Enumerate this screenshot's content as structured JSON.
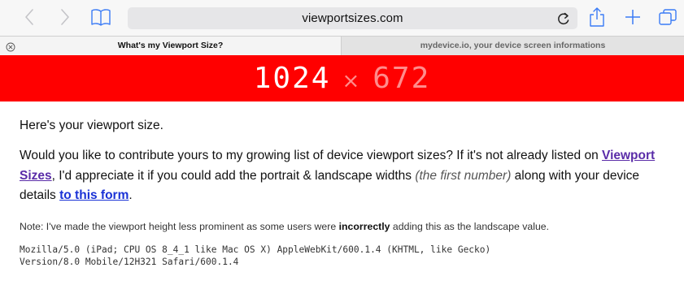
{
  "browser": {
    "address": "viewportsizes.com",
    "icons": {
      "back": "chevron-left-icon",
      "forward": "chevron-right-icon",
      "bookmarks": "open-book-icon",
      "reload": "reload-icon",
      "share": "share-icon",
      "new_tab": "plus-icon",
      "tabs": "tabs-overview-icon",
      "tab_close": "circle-x-icon"
    },
    "tabs": [
      {
        "label": "What's my Viewport Size?",
        "active": true
      },
      {
        "label": "mydevice.io, your device screen informations",
        "active": false
      }
    ]
  },
  "page": {
    "viewport": {
      "width": "1024",
      "separator": "×",
      "height": "672",
      "banner_color": "#ff0000"
    },
    "intro": "Here's your viewport size.",
    "contribute": {
      "text_1": "Would you like to contribute yours to my growing list of device viewport sizes? If it's not already listed on ",
      "link_viewport_sizes": "Viewport Sizes",
      "text_2": ", I'd appreciate it if you could add the portrait & landscape widths ",
      "emphasis": "(the first number)",
      "text_3": " along with your device details ",
      "link_form": "to this form",
      "text_4": "."
    },
    "note": {
      "text_1": "Note: I've made the viewport height less prominent as some users were ",
      "strong": "incorrectly",
      "text_2": " adding this as the landscape value."
    },
    "user_agent": {
      "line_1": "Mozilla/5.0 (iPad; CPU OS 8_4_1 like Mac OS X) AppleWebKit/600.1.4 (KHTML, like Gecko)",
      "line_2": "Version/8.0 Mobile/12H321 Safari/600.1.4"
    }
  }
}
